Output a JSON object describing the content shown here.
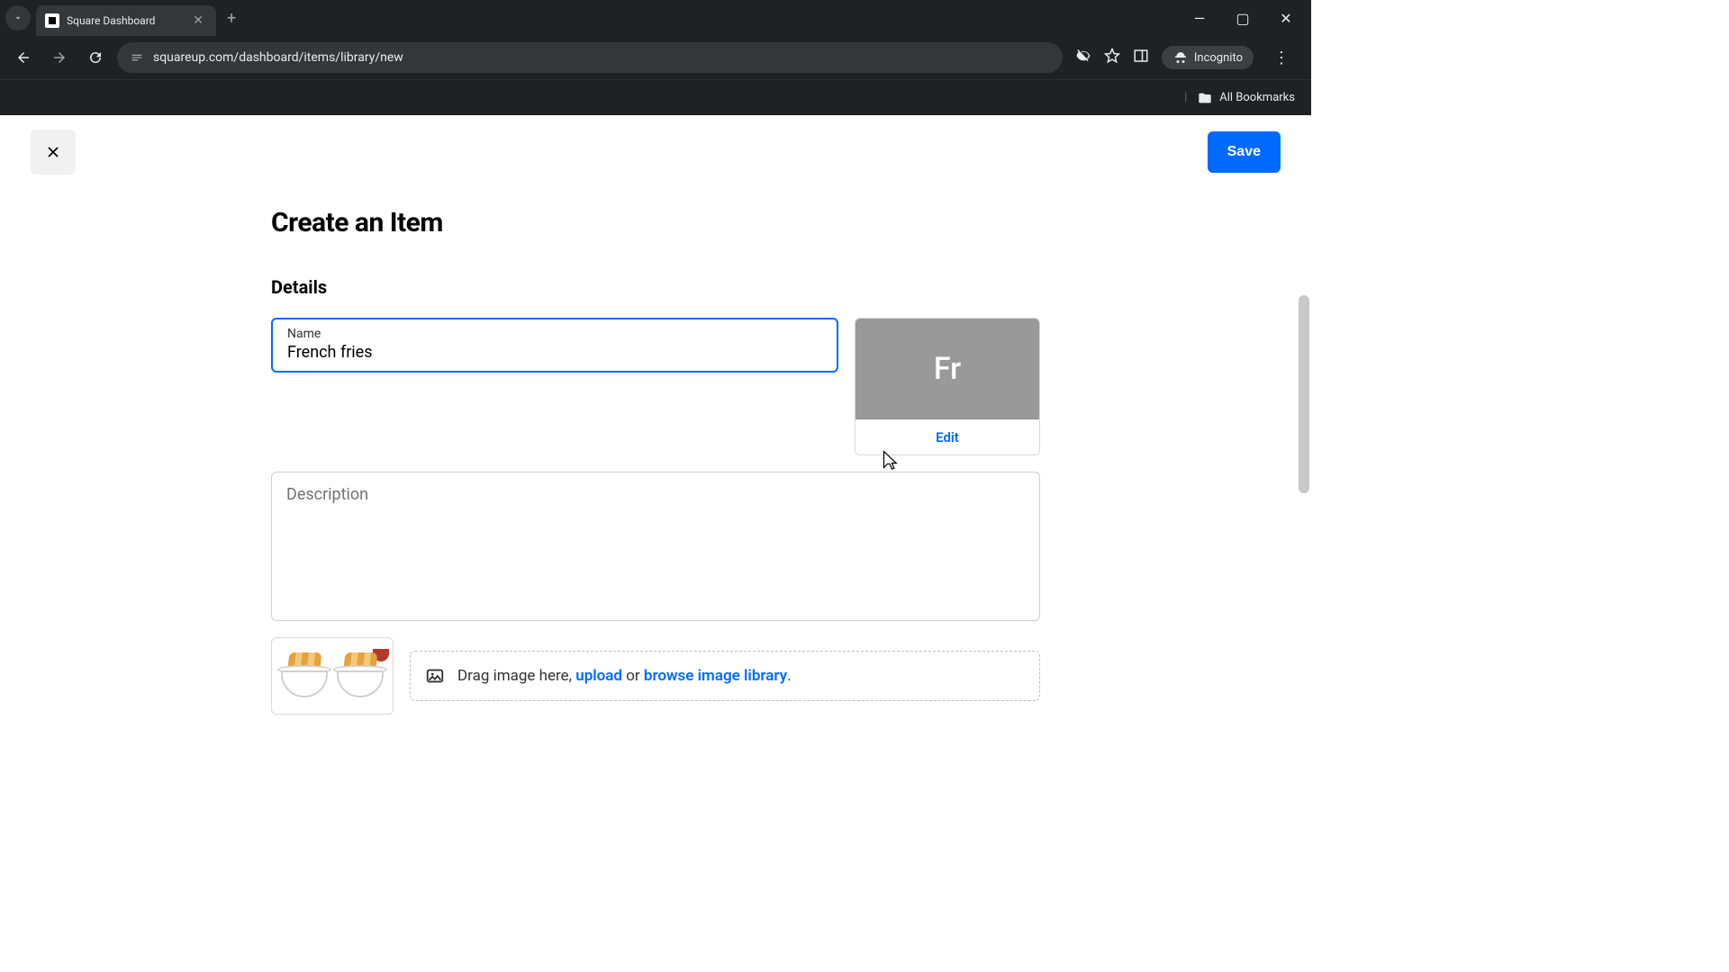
{
  "browser": {
    "tab_title": "Square Dashboard",
    "url": "squareup.com/dashboard/items/library/new",
    "incognito_label": "Incognito",
    "all_bookmarks": "All Bookmarks"
  },
  "header": {
    "save_label": "Save"
  },
  "page": {
    "title": "Create an Item",
    "details_section": "Details"
  },
  "name_field": {
    "label": "Name",
    "value": "French fries"
  },
  "image_tile": {
    "placeholder_text": "Fr",
    "edit_label": "Edit"
  },
  "description_field": {
    "placeholder": "Description",
    "value": ""
  },
  "dropzone": {
    "prefix": "Drag image here, ",
    "upload": "upload",
    "mid": " or ",
    "browse": "browse image library",
    "suffix": "."
  }
}
